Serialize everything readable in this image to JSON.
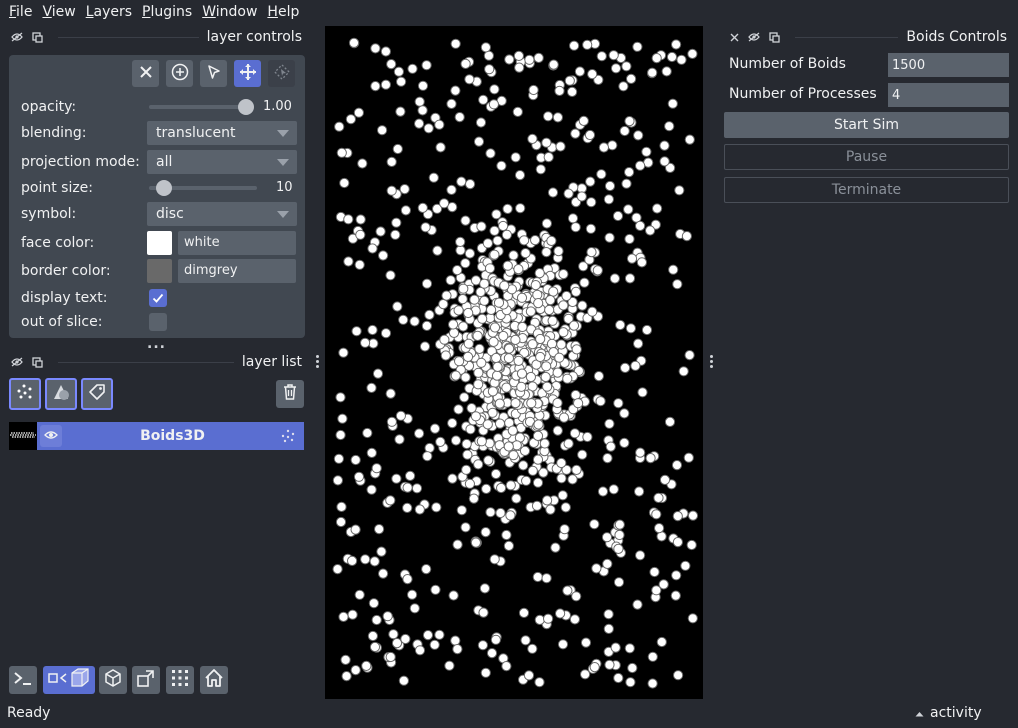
{
  "menu": [
    "File",
    "View",
    "Layers",
    "Plugins",
    "Window",
    "Help"
  ],
  "layer_controls": {
    "title": "layer controls",
    "opacity": {
      "label": "opacity:",
      "value": "1.00",
      "fraction": 1.0
    },
    "blending": {
      "label": "blending:",
      "value": "translucent"
    },
    "projection_mode": {
      "label": "projection mode:",
      "value": "all"
    },
    "point_size": {
      "label": "point size:",
      "value": "10"
    },
    "symbol": {
      "label": "symbol:",
      "value": "disc"
    },
    "face_color": {
      "label": "face color:",
      "value": "white",
      "swatch": "#ffffff"
    },
    "border_color": {
      "label": "border color:",
      "value": "dimgrey",
      "swatch": "#696969"
    },
    "display_text": {
      "label": "display text:",
      "checked": true
    },
    "out_of_slice": {
      "label": "out of slice:",
      "checked": false
    },
    "more": "..."
  },
  "layer_list": {
    "title": "layer list",
    "layers": [
      {
        "name": "Boids3D",
        "visible": true,
        "selected": true
      }
    ]
  },
  "boids_controls": {
    "title": "Boids Controls",
    "num_boids_label": "Number of Boids",
    "num_boids_value": "1500",
    "num_processes_label": "Number of Processes",
    "num_processes_value": "4",
    "start_label": "Start Sim",
    "pause_label": "Pause",
    "terminate_label": "Terminate"
  },
  "status": {
    "text": "Ready",
    "activity": "activity"
  },
  "colors": {
    "background": "#262930",
    "panel": "#414851",
    "accent": "#5a6ed1",
    "canvas": "#000000"
  }
}
